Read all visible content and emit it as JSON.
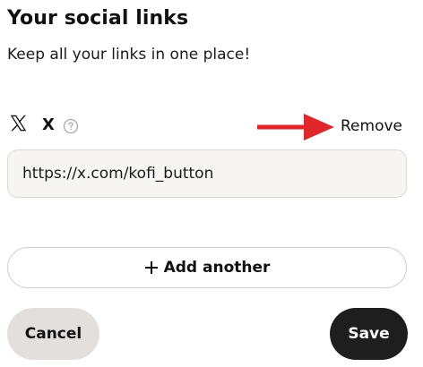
{
  "header": {
    "title": "Your social links",
    "subtitle": "Keep all your links in one place!"
  },
  "links": [
    {
      "network": "X",
      "icon": "x-logo-icon",
      "help_icon": "question-circle-icon",
      "remove_label": "Remove",
      "url": "https://x.com/kofi_button"
    }
  ],
  "annotation": {
    "icon": "red-arrow-icon",
    "color": "#e0262a"
  },
  "actions": {
    "add_label": "Add another",
    "add_icon": "plus-icon",
    "cancel_label": "Cancel",
    "save_label": "Save"
  },
  "colors": {
    "field_background": "#f7f5f3",
    "cancel_background": "#e3dfdd",
    "save_background": "#1e1e1e",
    "text": "#111111"
  }
}
